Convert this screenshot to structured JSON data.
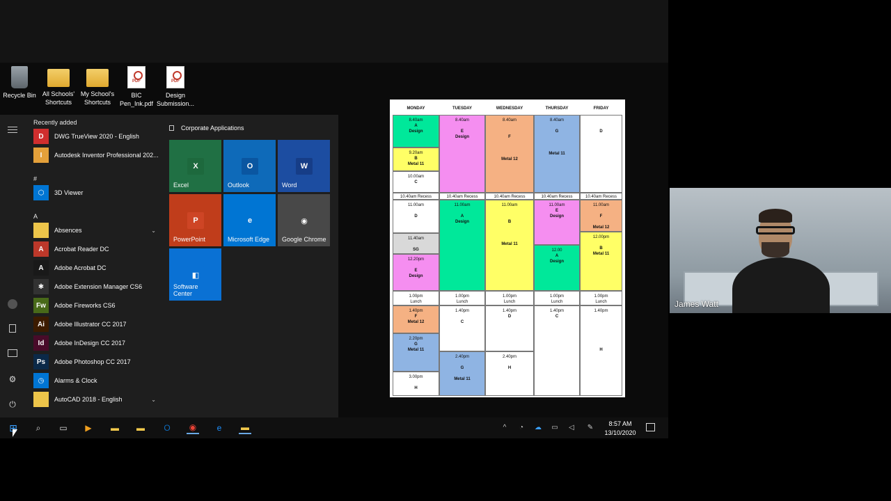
{
  "desktop": {
    "icons": [
      {
        "label": "Recycle Bin",
        "icon": "recycle-bin-icon"
      },
      {
        "label": "All Schools' Shortcuts",
        "icon": "folder-icon"
      },
      {
        "label": "My School's Shortcuts",
        "icon": "folder-icon"
      },
      {
        "label": "BIC Pen_Ink.pdf",
        "icon": "pdf-icon"
      },
      {
        "label": "Design Submission...",
        "icon": "pdf-icon"
      }
    ]
  },
  "start_menu": {
    "recently_added_label": "Recently added",
    "hash_label": "#",
    "a_label": "A",
    "apps": [
      {
        "label": "DWG TrueView 2020 - English",
        "glyph": "D",
        "color": "#d32f2f"
      },
      {
        "label": "Autodesk Inventor Professional 202...",
        "glyph": "I",
        "color": "#e8a33b"
      },
      {
        "label": "3D Viewer",
        "glyph": "⬡",
        "color": "#0078d7"
      },
      {
        "label": "Absences",
        "glyph": "",
        "color": "#f2c94c"
      },
      {
        "label": "Acrobat Reader DC",
        "glyph": "A",
        "color": "#c0392b"
      },
      {
        "label": "Adobe Acrobat DC",
        "glyph": "A",
        "color": "#1a1a1a"
      },
      {
        "label": "Adobe Extension Manager CS6",
        "glyph": "✱",
        "color": "#333333"
      },
      {
        "label": "Adobe Fireworks CS6",
        "glyph": "Fw",
        "color": "#4a6b1a"
      },
      {
        "label": "Adobe Illustrator CC 2017",
        "glyph": "Ai",
        "color": "#3d1c00"
      },
      {
        "label": "Adobe InDesign CC 2017",
        "glyph": "Id",
        "color": "#4a0b2a"
      },
      {
        "label": "Adobe Photoshop CC 2017",
        "glyph": "Ps",
        "color": "#0b2a4a"
      },
      {
        "label": "Alarms & Clock",
        "glyph": "◷",
        "color": "#0078d7"
      },
      {
        "label": "AutoCAD 2018 - English",
        "glyph": "",
        "color": "#f2c94c"
      }
    ],
    "tiles_header": "Corporate Applications",
    "tiles": [
      {
        "label": "Excel",
        "glyph": "X",
        "bg": "#217346",
        "glyph_bg": "#1e6b3f"
      },
      {
        "label": "Outlook",
        "glyph": "O",
        "bg": "#0f6cbd",
        "glyph_bg": "#0a58a5"
      },
      {
        "label": "Word",
        "glyph": "W",
        "bg": "#1d4fa5",
        "glyph_bg": "#173f8a"
      },
      {
        "label": "PowerPoint",
        "glyph": "P",
        "bg": "#c43e1c",
        "glyph_bg": "#d24726"
      },
      {
        "label": "Microsoft Edge",
        "glyph": "e",
        "bg": "#0078d7",
        "glyph_bg": "#0078d7"
      },
      {
        "label": "Google Chrome",
        "glyph": "◉",
        "bg": "#4a4a4a",
        "glyph_bg": "#4a4a4a"
      },
      {
        "label": "Software Center",
        "glyph": "◧",
        "bg": "#0a74d9",
        "glyph_bg": "#0a74d9"
      }
    ]
  },
  "timetable": {
    "days": [
      "MONDAY",
      "TUESDAY",
      "WEDNESDAY",
      "THURSDAY",
      "FRIDAY"
    ],
    "columns": [
      [
        {
          "lines": [
            "8.40am",
            "A",
            "Design"
          ],
          "color": "#00e89a"
        },
        {
          "lines": [
            "9.20am",
            "B",
            "Metal 11"
          ],
          "color": "#ffff66"
        },
        {
          "lines": [
            "10.00am",
            "C"
          ],
          "color": "#ffffff"
        },
        {
          "lines": [
            "10.40am  Recess"
          ],
          "color": "#ffffff"
        },
        {
          "lines": [
            "11.00am",
            "",
            "D"
          ],
          "color": "#ffffff"
        },
        {
          "lines": [
            "11.40am",
            "",
            "SG"
          ],
          "color": "#d9d9d9"
        },
        {
          "lines": [
            "12.20pm",
            "",
            "E",
            "Design"
          ],
          "color": "#f58ef0"
        },
        {
          "lines": [
            "1.00pm",
            "Lunch"
          ],
          "color": "#ffffff"
        },
        {
          "lines": [
            "1.40pm",
            "F",
            "Metal 12"
          ],
          "color": "#f5b183"
        },
        {
          "lines": [
            "2.20pm",
            "G",
            "Metal 11"
          ],
          "color": "#8fb4e3"
        },
        {
          "lines": [
            "3.00pm",
            "",
            "H"
          ],
          "color": "#ffffff"
        }
      ],
      [
        {
          "lines": [
            "8.40am",
            "",
            "E",
            "Design"
          ],
          "color": "#f58ef0"
        },
        {
          "lines": [
            "10.40am  Recess"
          ],
          "color": "#ffffff"
        },
        {
          "lines": [
            "11.00am",
            "",
            "A",
            "Design"
          ],
          "color": "#00e89a"
        },
        {
          "lines": [
            "1.00pm",
            "Lunch"
          ],
          "color": "#ffffff"
        },
        {
          "lines": [
            "1.40pm",
            "",
            "C"
          ],
          "color": "#ffffff"
        },
        {
          "lines": [
            "2.40pm",
            "",
            "G",
            "",
            "Metal 11"
          ],
          "color": "#8fb4e3"
        }
      ],
      [
        {
          "lines": [
            "8.40am",
            "",
            "",
            "F",
            "",
            "",
            "",
            "Metal 12"
          ],
          "color": "#f5b183"
        },
        {
          "lines": [
            "10.40am  Recess"
          ],
          "color": "#ffffff"
        },
        {
          "lines": [
            "11.00am",
            "",
            "",
            "B",
            "",
            "",
            "",
            "Metal 11"
          ],
          "color": "#ffff66"
        },
        {
          "lines": [
            "1.00pm",
            "Lunch"
          ],
          "color": "#ffffff"
        },
        {
          "lines": [
            "1.40pm",
            "D"
          ],
          "color": "#ffffff"
        },
        {
          "lines": [
            "2.40pm",
            "",
            "H"
          ],
          "color": "#ffffff"
        }
      ],
      [
        {
          "lines": [
            "8.40am",
            "",
            "G",
            "",
            "",
            "",
            "Metal 11"
          ],
          "color": "#8fb4e3"
        },
        {
          "lines": [
            "10.40am  Recess"
          ],
          "color": "#ffffff"
        },
        {
          "lines": [
            "11.00am",
            "E",
            "Design"
          ],
          "color": "#f58ef0"
        },
        {
          "lines": [
            "12.00",
            "A",
            "Design"
          ],
          "color": "#00e89a"
        },
        {
          "lines": [
            "1.00pm",
            "Lunch"
          ],
          "color": "#ffffff"
        },
        {
          "lines": [
            "1.40pm",
            "C"
          ],
          "color": "#ffffff"
        }
      ],
      [
        {
          "lines": [
            "",
            "",
            "D"
          ],
          "color": "#ffffff"
        },
        {
          "lines": [
            "10.40am  Recess"
          ],
          "color": "#ffffff"
        },
        {
          "lines": [
            "11.00am",
            "",
            "F",
            "",
            "Metal 12"
          ],
          "color": "#f5b183"
        },
        {
          "lines": [
            "12.00pm",
            "",
            "B",
            "Metal 11"
          ],
          "color": "#ffff66"
        },
        {
          "lines": [
            "1.00pm",
            "Lunch"
          ],
          "color": "#ffffff"
        },
        {
          "lines": [
            "1.40pm",
            "",
            "",
            "",
            "",
            "",
            "",
            "H"
          ],
          "color": "#ffffff"
        }
      ]
    ]
  },
  "taskbar": {
    "time": "8:57 AM",
    "date": "13/10/2020"
  },
  "webcam": {
    "name": "James Watt"
  }
}
